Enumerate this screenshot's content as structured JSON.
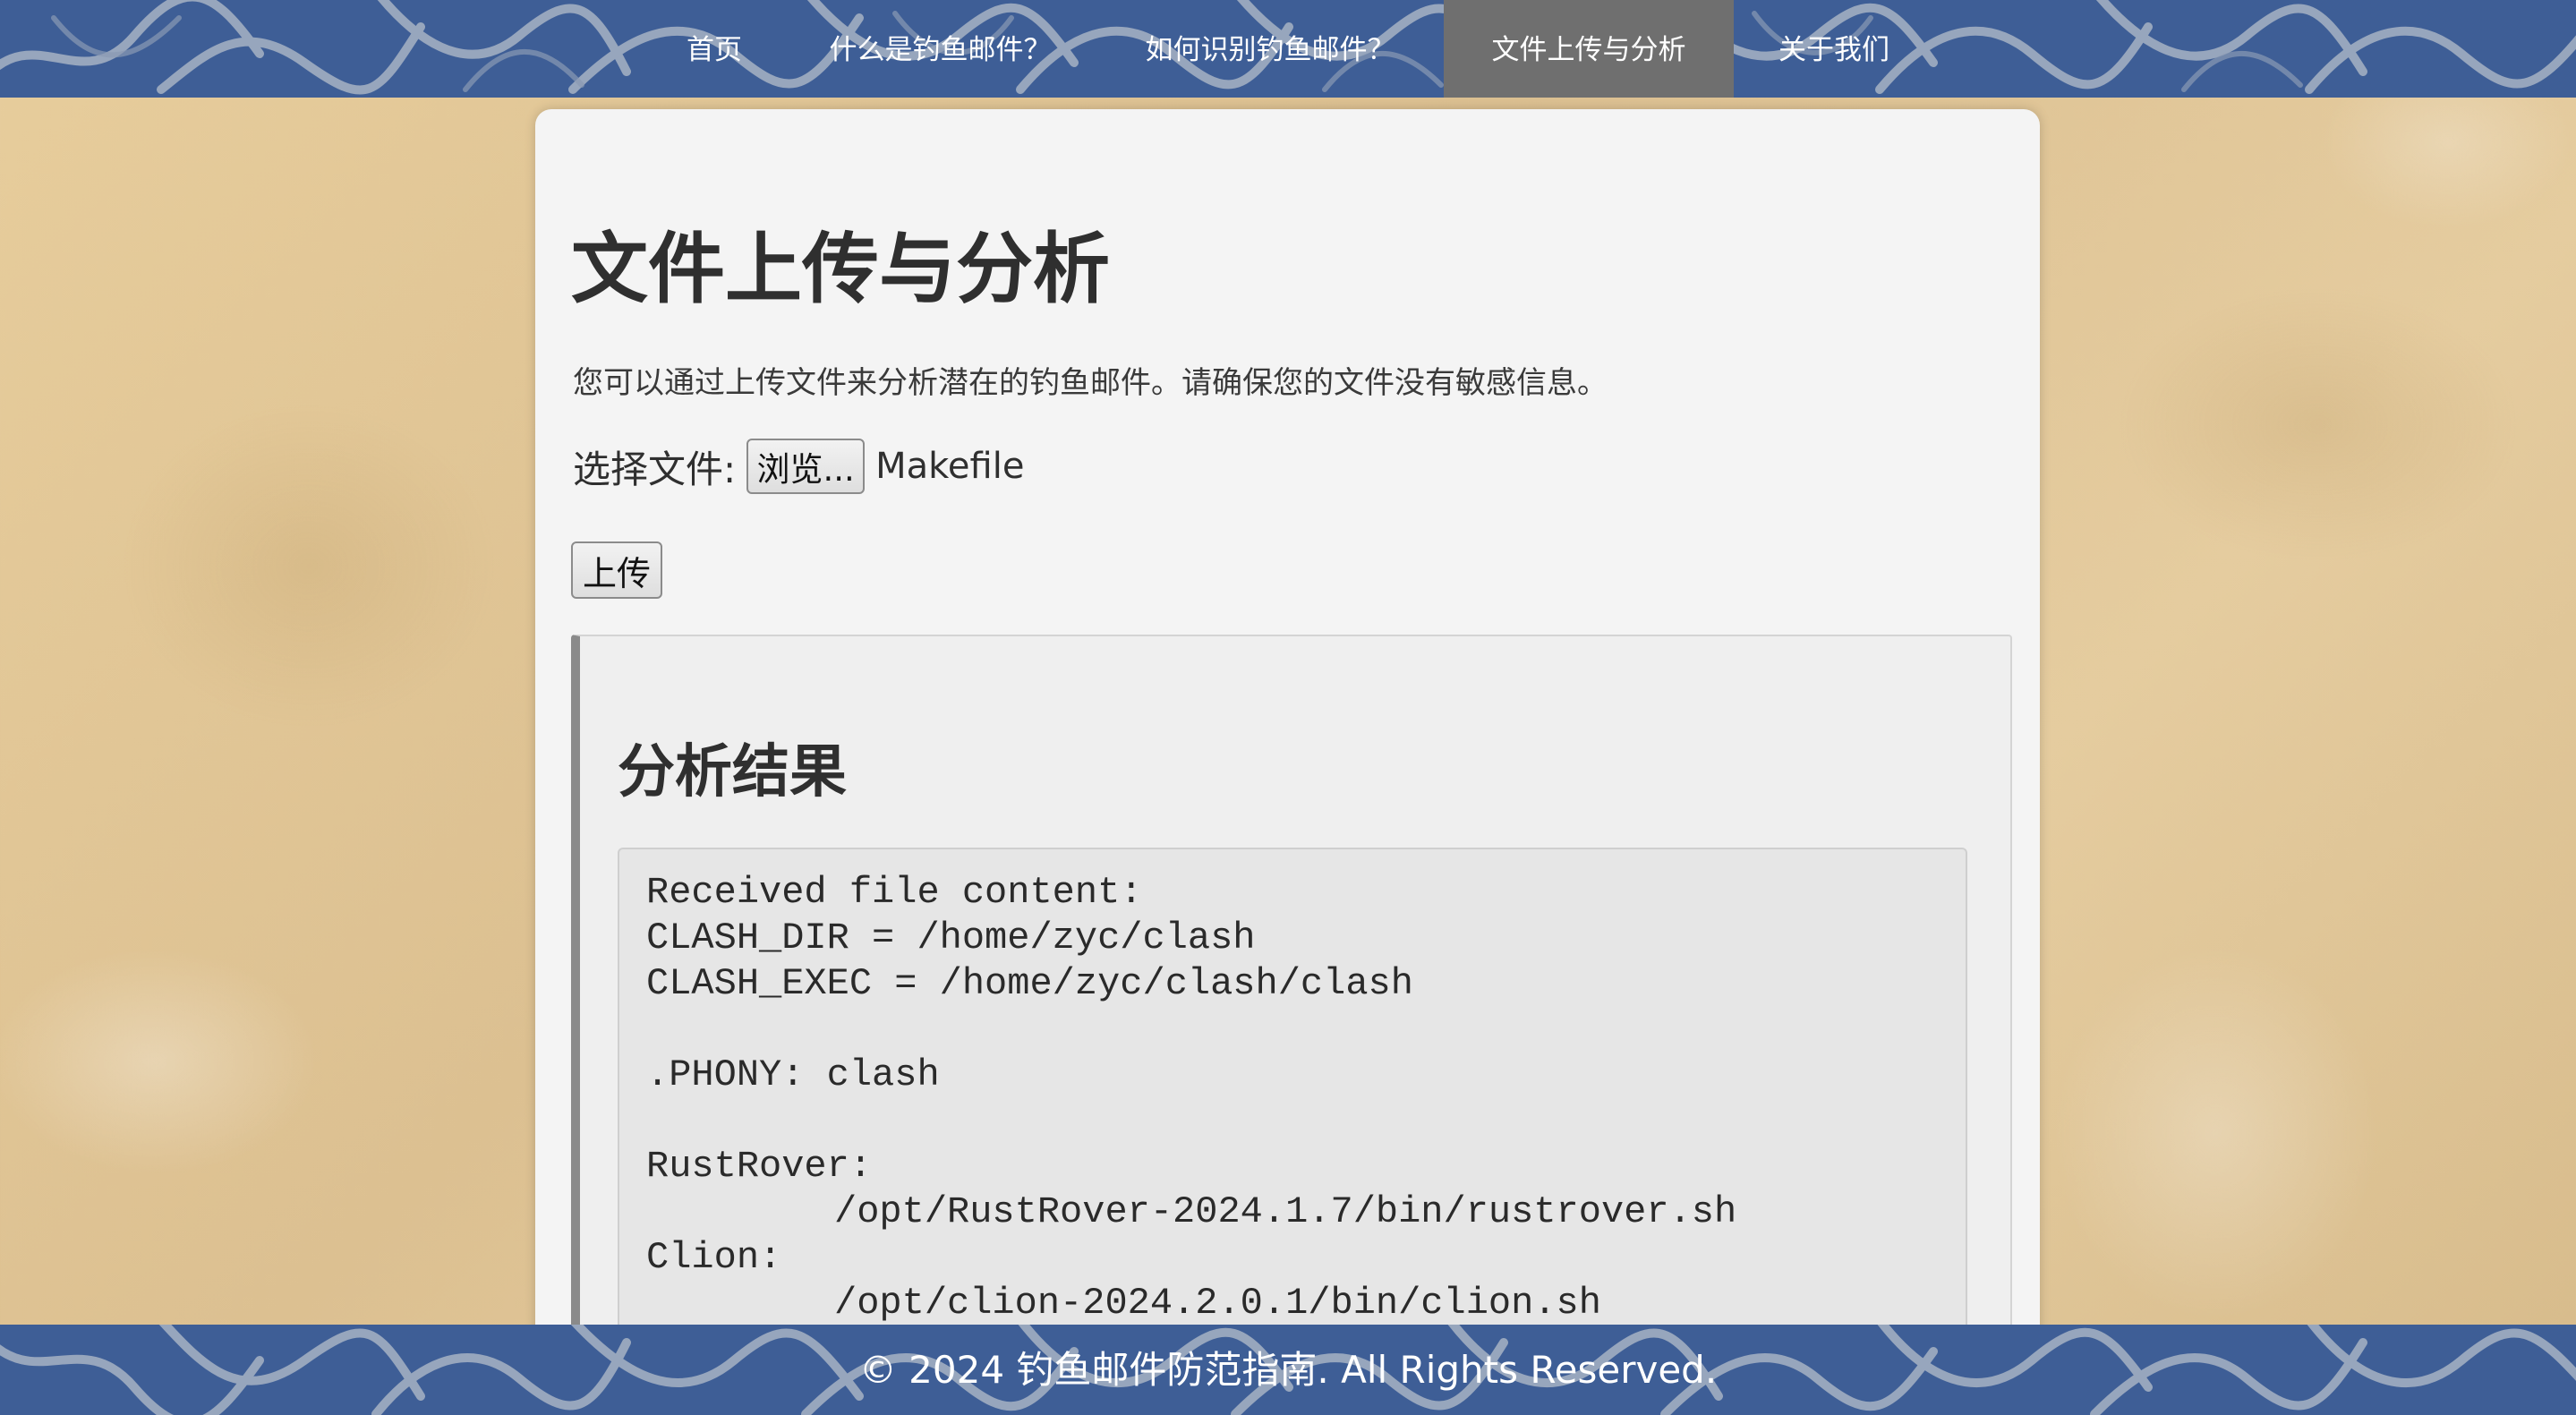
{
  "nav": {
    "items": [
      {
        "label": "首页"
      },
      {
        "label": "什么是钓鱼邮件？"
      },
      {
        "label": "如何识别钓鱼邮件？"
      },
      {
        "label": "文件上传与分析"
      },
      {
        "label": "关于我们"
      }
    ],
    "active_index": 3
  },
  "main": {
    "title": "文件上传与分析",
    "intro": "您可以通过上传文件来分析潜在的钓鱼邮件。请确保您的文件没有敏感信息。",
    "file_label": "选择文件:",
    "browse_label": "浏览...",
    "selected_file": "Makefile",
    "upload_label": "上传"
  },
  "result": {
    "title": "分析结果",
    "code_lines": [
      "Received file content:",
      "CLASH_DIR = /home/zyc/clash",
      "CLASH_EXEC = /home/zyc/clash/clash",
      "",
      ".PHONY: clash",
      "",
      "RustRover:",
      "/opt/RustRover-2024.1.7/bin/rustrover.sh",
      "Clion:",
      "/opt/clion-2024.2.0.1/bin/clion.sh"
    ]
  },
  "footer": {
    "text": "© 2024 钓鱼邮件防范指南. All Rights Reserved."
  },
  "colors": {
    "nav_bg": "#3e5e96",
    "nav_active_bg": "#6f6f6f",
    "card_bg": "#f4f4f4",
    "page_bg": "#e3c896"
  }
}
